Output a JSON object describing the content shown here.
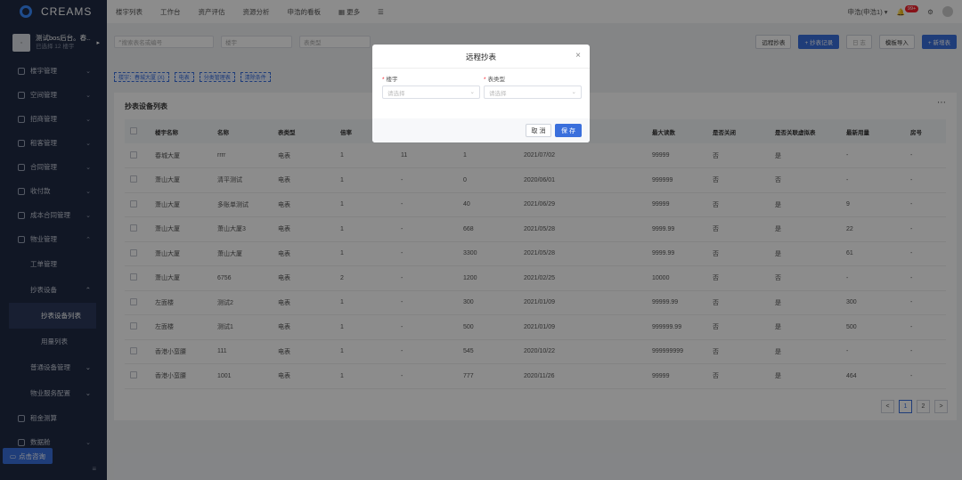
{
  "sidebar": {
    "logo": "CREAMS",
    "project": {
      "name": "测试bos后台。春...",
      "sub": "已选择 12 楼宇"
    },
    "menu": [
      {
        "label": "楼宇管理"
      },
      {
        "label": "空间管理"
      },
      {
        "label": "招商管理"
      },
      {
        "label": "租客管理"
      },
      {
        "label": "合同管理"
      },
      {
        "label": "收付款"
      },
      {
        "label": "成本合同管理"
      },
      {
        "label": "物业管理"
      }
    ],
    "sub_work_orders": "工单管理",
    "sub_meter": "抄表设备",
    "sub_meter_list": "抄表设备列表",
    "sub_usage_list": "用量列表",
    "sub_common_equipment": "普通设备管理",
    "sub_property_config": "物业服务配置",
    "rent_calc": "租金测算",
    "data": "数据舱",
    "chat_button": "点击咨询",
    "collapse_icon": "≡"
  },
  "topbar": {
    "items": [
      "楼宇列表",
      "工作台",
      "资产评估",
      "资源分析",
      "申浩的看板"
    ],
    "more": "更多",
    "menu_glyph": "☰",
    "user": "申浩(申浩1)",
    "badge": "99+"
  },
  "filters": {
    "search_placeholder": "搜索表名或编号",
    "building_placeholder": "楼宇",
    "meter_type_placeholder": "表类型"
  },
  "buttons": {
    "remote": "远程抄表",
    "record": "+ 抄表记录",
    "disabled": "日 志",
    "import": "模板导入",
    "add": "+ 新增表"
  },
  "tags": [
    "楼宇：春城大厦 (X)",
    "电表",
    "分类管理表",
    "清除条件"
  ],
  "card": {
    "title": "抄表设备列表",
    "more": "⋯"
  },
  "table": {
    "headers": [
      "楼宇名称",
      "名称",
      "表类型",
      "倍率",
      "",
      "",
      "",
      "最大读数",
      "是否关闭",
      "是否关联虚拟表",
      "最新用量",
      "房号"
    ],
    "rows": [
      [
        "春城大厦",
        "rrrr",
        "电表",
        "1",
        "11",
        "1",
        "2021/07/02",
        "99999",
        "否",
        "是",
        "-",
        "-"
      ],
      [
        "萧山大厦",
        "清平测试",
        "电表",
        "1",
        "-",
        "0",
        "2020/06/01",
        "999999",
        "否",
        "否",
        "-",
        "-"
      ],
      [
        "萧山大厦",
        "多账单测试",
        "电表",
        "1",
        "-",
        "40",
        "2021/06/29",
        "99999",
        "否",
        "是",
        "9",
        "-"
      ],
      [
        "萧山大厦",
        "萧山大厦3",
        "电表",
        "1",
        "-",
        "668",
        "2021/05/28",
        "9999.99",
        "否",
        "是",
        "22",
        "-"
      ],
      [
        "萧山大厦",
        "萧山大厦",
        "电表",
        "1",
        "-",
        "3300",
        "2021/05/28",
        "9999.99",
        "否",
        "是",
        "61",
        "-"
      ],
      [
        "萧山大厦",
        "6756",
        "电表",
        "2",
        "-",
        "1200",
        "2021/02/25",
        "10000",
        "否",
        "否",
        "-",
        "-"
      ],
      [
        "左面楼",
        "测试2",
        "电表",
        "1",
        "-",
        "300",
        "2021/01/09",
        "99999.99",
        "否",
        "是",
        "300",
        "-"
      ],
      [
        "左面楼",
        "测试1",
        "电表",
        "1",
        "-",
        "500",
        "2021/01/09",
        "999999.99",
        "否",
        "是",
        "500",
        "-"
      ],
      [
        "香港小蛮腰",
        "111",
        "电表",
        "1",
        "-",
        "545",
        "2020/10/22",
        "999999999",
        "否",
        "是",
        "-",
        "-"
      ],
      [
        "香港小蛮腰",
        "1001",
        "电表",
        "1",
        "-",
        "777",
        "2020/11/26",
        "99999",
        "否",
        "是",
        "464",
        "-"
      ]
    ]
  },
  "pager": {
    "prev": "<",
    "p1": "1",
    "p2": "2",
    "next": ">"
  },
  "modal": {
    "title": "远程抄表",
    "close": "×",
    "field1_label": "楼宇",
    "field1_placeholder": "请选择",
    "field2_label": "表类型",
    "field2_placeholder": "请选择",
    "cancel": "取 消",
    "save": "保 存"
  }
}
